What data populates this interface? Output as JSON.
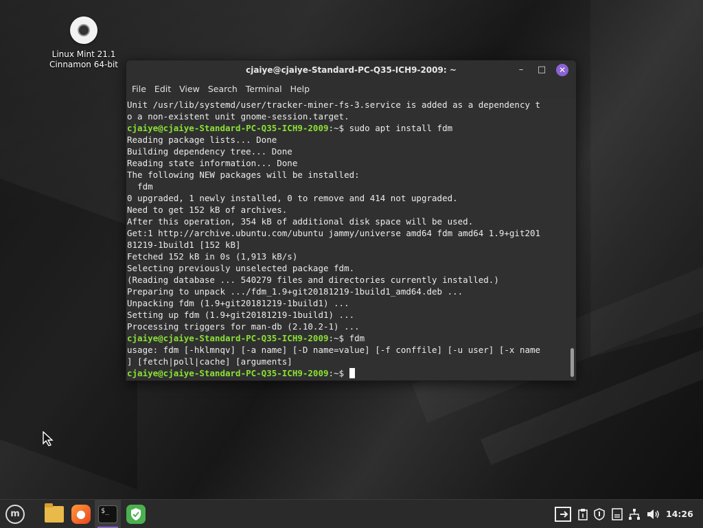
{
  "desktop": {
    "icon_label_line1": "Linux Mint 21.1",
    "icon_label_line2": "Cinnamon 64-bit"
  },
  "window": {
    "title": "cjaiye@cjaiye-Standard-PC-Q35-ICH9-2009: ~",
    "menu": [
      "File",
      "Edit",
      "View",
      "Search",
      "Terminal",
      "Help"
    ]
  },
  "terminal": {
    "prompt": "cjaiye@cjaiye-Standard-PC-Q35-ICH9-2009",
    "prompt_suffix": ":~$ ",
    "lines": [
      "Unit /usr/lib/systemd/user/tracker-miner-fs-3.service is added as a dependency t",
      "o a non-existent unit gnome-session.target.",
      "sudo apt install fdm",
      "Reading package lists... Done",
      "Building dependency tree... Done",
      "Reading state information... Done",
      "The following NEW packages will be installed:",
      "  fdm",
      "0 upgraded, 1 newly installed, 0 to remove and 414 not upgraded.",
      "Need to get 152 kB of archives.",
      "After this operation, 354 kB of additional disk space will be used.",
      "Get:1 http://archive.ubuntu.com/ubuntu jammy/universe amd64 fdm amd64 1.9+git201",
      "81219-1build1 [152 kB]",
      "Fetched 152 kB in 0s (1,913 kB/s)",
      "Selecting previously unselected package fdm.",
      "(Reading database ... 540279 files and directories currently installed.)",
      "Preparing to unpack .../fdm_1.9+git20181219-1build1_amd64.deb ...",
      "Unpacking fdm (1.9+git20181219-1build1) ...",
      "Setting up fdm (1.9+git20181219-1build1) ...",
      "Processing triggers for man-db (2.10.2-1) ...",
      "fdm",
      "usage: fdm [-hklmnqv] [-a name] [-D name=value] [-f conffile] [-u user] [-x name",
      "] [fetch|poll|cache] [arguments]",
      ""
    ]
  },
  "taskbar": {
    "menu_icon": "linux-mint-logo",
    "apps": [
      "file-manager-icon",
      "firefox-icon",
      "terminal-icon",
      "update-manager-shield-icon"
    ],
    "tray": [
      "workspace-switcher-icon",
      "clipboard-notes-icon",
      "network-shield-icon",
      "display-icon",
      "network-icon",
      "volume-icon"
    ],
    "clock": "14:26"
  },
  "colors": {
    "prompt": "#8ae234",
    "accent": "#8a63d2",
    "terminal_bg": "#303030"
  }
}
